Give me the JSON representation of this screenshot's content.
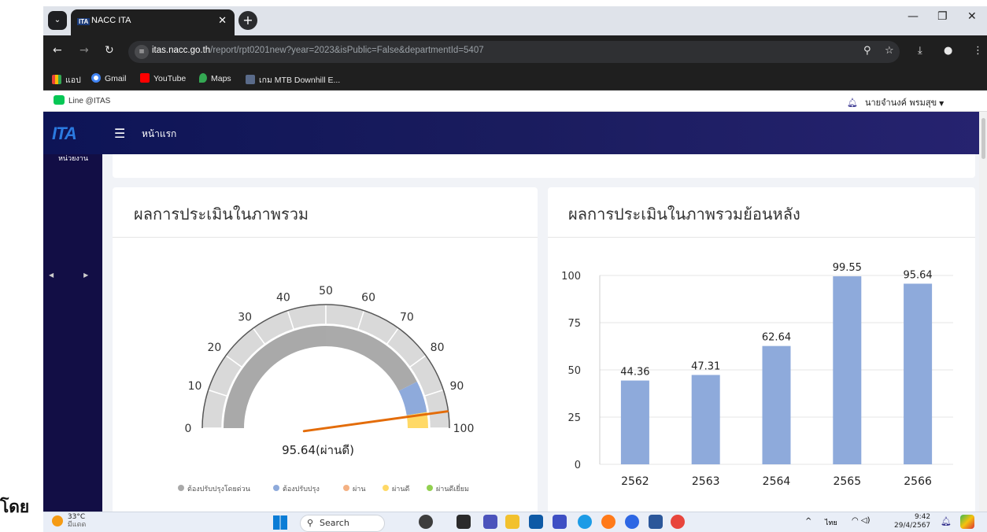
{
  "browser": {
    "tab_title": "NACC ITA",
    "tab_favicon_text": "ITA",
    "url_host": "itas.nacc.go.th",
    "url_path": "/report/rpt0201new?year=2023&isPublic=False&departmentId=5407",
    "bookmarks": [
      {
        "label": "แอป",
        "icon": "apps-grid-icon"
      },
      {
        "label": "Gmail",
        "icon": "google-icon"
      },
      {
        "label": "YouTube",
        "icon": "youtube-icon"
      },
      {
        "label": "Maps",
        "icon": "maps-pin-icon"
      },
      {
        "label": "เกม MTB Downhill E...",
        "icon": "game-icon"
      }
    ]
  },
  "site": {
    "line_label": "Line @ITAS",
    "user_name": "นายจำนงค์ พรมสุข",
    "logo_text": "ITA",
    "home_label": "หน้าแรก",
    "sidebar_label": "หน่วยงาน"
  },
  "cards": {
    "overall_title": "ผลการประเมินในภาพรวม",
    "history_title": "ผลการประเมินในภาพรวมย้อนหลัง"
  },
  "gauge": {
    "value": 95.64,
    "value_label": "95.64(ผ่านดี)",
    "ticks": [
      "0",
      "10",
      "20",
      "30",
      "40",
      "50",
      "60",
      "70",
      "80",
      "90",
      "100"
    ],
    "bands": [
      {
        "from": 0,
        "to": 50,
        "color": "#a9a9a9"
      },
      {
        "from": 50,
        "to": 85,
        "color": "#aaaaaa"
      },
      {
        "from": 85,
        "to": 95,
        "color": "#8eaadb"
      },
      {
        "from": 95,
        "to": 100,
        "color": "#ffd966"
      }
    ],
    "needle_color": "#e36c09",
    "legend": [
      {
        "label": "ต้องปรับปรุงโดยด่วน",
        "color": "#a9a9a9"
      },
      {
        "label": "ต้องปรับปรุง",
        "color": "#8eaadb"
      },
      {
        "label": "ผ่าน",
        "color": "#f4b183"
      },
      {
        "label": "ผ่านดี",
        "color": "#ffd966"
      },
      {
        "label": "ผ่านดีเยี่ยม",
        "color": "#92d050"
      }
    ]
  },
  "chart_data": {
    "type": "bar",
    "categories": [
      "2562",
      "2563",
      "2564",
      "2565",
      "2566"
    ],
    "values": [
      44.36,
      47.31,
      62.64,
      99.55,
      95.64
    ],
    "value_labels": [
      "44.36",
      "47.31",
      "62.64",
      "99.55",
      "95.64"
    ],
    "yticks": [
      "0",
      "25",
      "50",
      "75",
      "100"
    ],
    "ylim": [
      0,
      100
    ],
    "bar_color": "#8eaadb",
    "grid": true
  },
  "page_left_text": "โดย",
  "taskbar": {
    "weather_temp": "33°C",
    "weather_desc": "มีแดด",
    "search_placeholder": "Search",
    "lang": "ไทย",
    "time": "9:42",
    "date": "29/4/2567"
  }
}
